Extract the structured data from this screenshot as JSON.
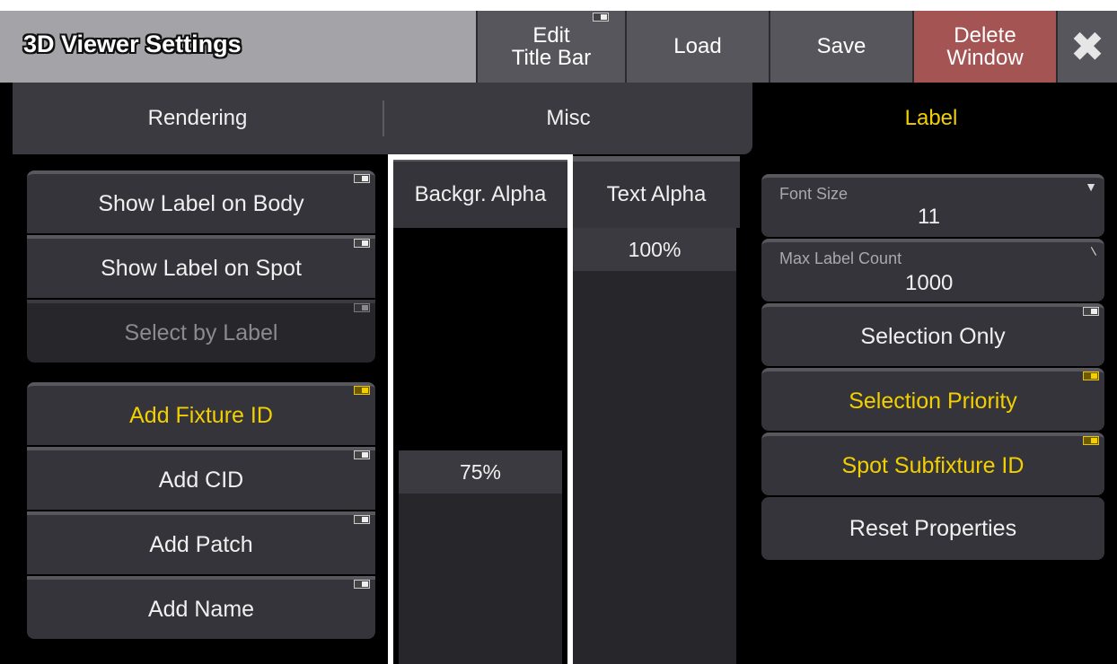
{
  "window": {
    "title": "3D Viewer Settings"
  },
  "titlebar": {
    "edit_title_bar": "Edit\nTitle Bar",
    "load": "Load",
    "save": "Save",
    "delete_window": "Delete\nWindow",
    "close_glyph": "✖"
  },
  "tabs": [
    {
      "label": "Rendering",
      "active": false
    },
    {
      "label": "Misc",
      "active": false
    },
    {
      "label": "Label",
      "active": true
    }
  ],
  "left_buttons": [
    {
      "label": "Show Label on Body",
      "state": "off"
    },
    {
      "label": "Show Label on Spot",
      "state": "off"
    },
    {
      "label": "Select by Label",
      "state": "disabled"
    },
    {
      "label": "Add Fixture ID",
      "state": "on"
    },
    {
      "label": "Add CID",
      "state": "off"
    },
    {
      "label": "Add Patch",
      "state": "off"
    },
    {
      "label": "Add Name",
      "state": "off"
    }
  ],
  "faders": {
    "background_alpha": {
      "label": "Backgr. Alpha",
      "value_text": "75%",
      "level": 0.75
    },
    "text_alpha": {
      "label": "Text Alpha",
      "value_text": "100%",
      "level": 1.0
    }
  },
  "right_panel": {
    "font_size": {
      "label": "Font Size",
      "value": "11"
    },
    "max_label_count": {
      "label": "Max Label Count",
      "value": "1000"
    },
    "selection_only": {
      "label": "Selection Only",
      "state": "off"
    },
    "selection_priority": {
      "label": "Selection Priority",
      "state": "on"
    },
    "spot_subfixture_id": {
      "label": "Spot Subfixture ID",
      "state": "on"
    },
    "reset_properties": {
      "label": "Reset Properties"
    }
  },
  "colors": {
    "accent_active": "#f2cf00",
    "delete_button": "#a55454",
    "highlight_frame": "#ffffff"
  }
}
